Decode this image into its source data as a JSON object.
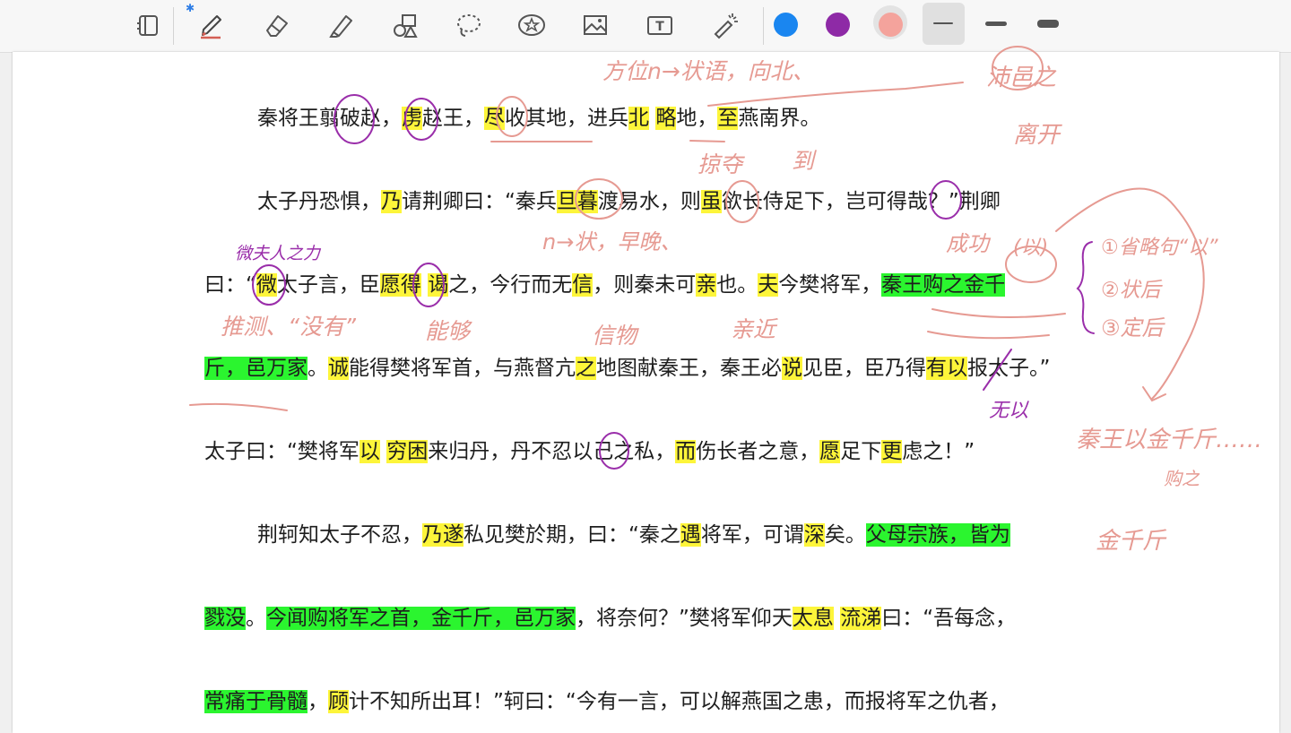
{
  "toolbar": {
    "tools": [
      {
        "name": "page-layout-icon"
      },
      {
        "name": "pen-icon",
        "bluetooth": "✱"
      },
      {
        "name": "eraser-icon"
      },
      {
        "name": "highlighter-icon"
      },
      {
        "name": "shapes-icon"
      },
      {
        "name": "lasso-icon"
      },
      {
        "name": "sticker-icon"
      },
      {
        "name": "image-icon"
      },
      {
        "name": "text-icon",
        "glyph": "T"
      },
      {
        "name": "laser-pointer-icon"
      }
    ],
    "colors": [
      "#1a86f0",
      "#8e2aa6",
      "#f4a39c"
    ],
    "selected_color_index": 2
  },
  "text_lines": [
    [
      [
        "秦将王翦",
        ""
      ],
      [
        "破",
        ""
      ],
      [
        "赵，",
        ""
      ],
      [
        "虏",
        "y"
      ],
      [
        "赵王，",
        ""
      ],
      [
        "尽",
        "y"
      ],
      [
        "收其地，进兵",
        ""
      ],
      [
        "北",
        "y"
      ],
      [
        "  ",
        ""
      ],
      [
        "略",
        "y"
      ],
      [
        "地，",
        ""
      ],
      [
        "至",
        "y"
      ],
      [
        "燕南界。",
        ""
      ]
    ],
    [
      [
        "太子丹恐惧，",
        ""
      ],
      [
        "乃",
        "y"
      ],
      [
        "请荆卿曰：“秦兵",
        ""
      ],
      [
        "旦暮",
        "y"
      ],
      [
        "渡易水，则",
        ""
      ],
      [
        "虽",
        "y"
      ],
      [
        "欲长侍足下，岂可得哉？”荆卿",
        ""
      ]
    ],
    [
      [
        "曰：“",
        ""
      ],
      [
        "微",
        "y"
      ],
      [
        "太子言，臣",
        ""
      ],
      [
        "愿得",
        "y"
      ],
      [
        "  ",
        ""
      ],
      [
        "谒",
        "y"
      ],
      [
        "之，今行而无",
        ""
      ],
      [
        "信",
        "y"
      ],
      [
        "，则秦未可",
        ""
      ],
      [
        "亲",
        "y"
      ],
      [
        "也。",
        ""
      ],
      [
        "夫",
        "y"
      ],
      [
        "今樊将军，",
        ""
      ],
      [
        "秦王购之金千",
        "g"
      ]
    ],
    [
      [
        "斤，邑万家",
        "g"
      ],
      [
        "。",
        ""
      ],
      [
        "诚",
        "y"
      ],
      [
        "能得樊将军首，与燕督亢",
        ""
      ],
      [
        "之",
        "y"
      ],
      [
        "地图献秦王，秦王必",
        ""
      ],
      [
        "说",
        "y"
      ],
      [
        "见臣，臣乃得",
        ""
      ],
      [
        "有以",
        "y"
      ],
      [
        "报太子。”",
        ""
      ]
    ],
    [
      [
        "太子曰：“樊将军",
        ""
      ],
      [
        "以",
        "y"
      ],
      [
        "  ",
        ""
      ],
      [
        "穷困",
        "y"
      ],
      [
        "来归丹，丹不忍以己之私，",
        ""
      ],
      [
        "而",
        "y"
      ],
      [
        "伤长者之意，",
        ""
      ],
      [
        "愿",
        "y"
      ],
      [
        "足下",
        ""
      ],
      [
        "更",
        "y"
      ],
      [
        "虑之！”",
        ""
      ]
    ],
    [
      [
        "荆轲知太子不忍，",
        ""
      ],
      [
        "乃遂",
        "y"
      ],
      [
        "私见樊於期，曰：“秦之",
        ""
      ],
      [
        "遇",
        "y"
      ],
      [
        "将军，可谓",
        ""
      ],
      [
        "深",
        "y"
      ],
      [
        "矣。",
        ""
      ],
      [
        "父母宗族，皆为",
        "g"
      ]
    ],
    [
      [
        "戮没",
        "g"
      ],
      [
        "。",
        ""
      ],
      [
        "今闻购将军之首，金千斤，邑万家",
        "g"
      ],
      [
        "，将奈何？”樊将军仰天",
        ""
      ],
      [
        "太息",
        "y"
      ],
      [
        "  ",
        ""
      ],
      [
        "流涕",
        "y"
      ],
      [
        "曰：“吾每念，",
        ""
      ]
    ],
    [
      [
        "常痛于骨髓",
        "g"
      ],
      [
        "，",
        ""
      ],
      [
        "顾",
        "y"
      ],
      [
        "计不知所出耳！”轲曰：“今有一言，可以解燕国之患，而报将军之仇者，",
        ""
      ]
    ]
  ],
  "handwritten_notes": [
    {
      "text": "方位n→状语，向北、",
      "color": "#e69a92"
    },
    {
      "text": "沛邑之",
      "color": "#e69a92"
    },
    {
      "text": "离开",
      "color": "#e69a92"
    },
    {
      "text": "掠夺",
      "color": "#e69a92"
    },
    {
      "text": "到",
      "color": "#e69a92"
    },
    {
      "text": "n→状，早晚、",
      "color": "#e69a92"
    },
    {
      "text": "成功",
      "color": "#e69a92"
    },
    {
      "text": "(以)",
      "color": "#e69a92"
    },
    {
      "text": "①省略句“以”",
      "color": "#e69a92"
    },
    {
      "text": "②状后",
      "color": "#e69a92"
    },
    {
      "text": "③定后",
      "color": "#e69a92"
    },
    {
      "text": "微夫人之力",
      "color": "#9a2eaa"
    },
    {
      "text": "推测、“没有”",
      "color": "#e69a92"
    },
    {
      "text": "能够",
      "color": "#e69a92"
    },
    {
      "text": "信物",
      "color": "#e69a92"
    },
    {
      "text": "亲近",
      "color": "#e69a92"
    },
    {
      "text": "无以",
      "color": "#9a2eaa"
    },
    {
      "text": "秦王以金千斤……",
      "color": "#e69a92"
    },
    {
      "text": "购之",
      "color": "#e69a92"
    },
    {
      "text": "金千斤",
      "color": "#e69a92"
    }
  ]
}
